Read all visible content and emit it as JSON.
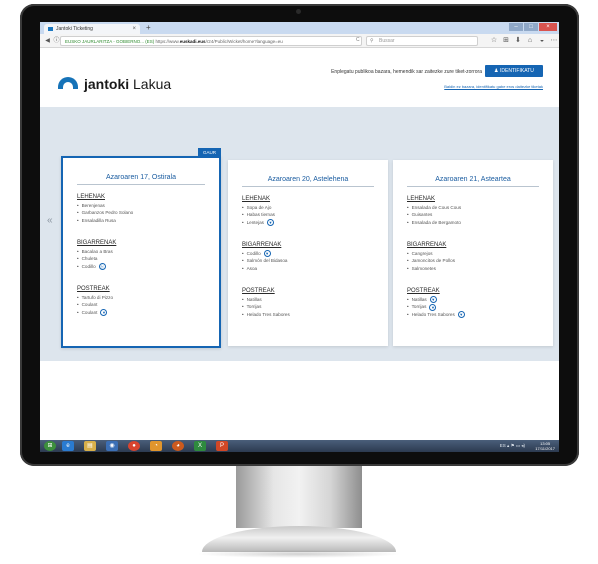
{
  "browser": {
    "tab_title": "Jantoki Ticketing",
    "tab_close": "×",
    "new_tab": "+",
    "window_controls": [
      "–",
      "□",
      "×"
    ],
    "back": "◀",
    "info": "ⓘ",
    "url_secure": "EUSKO JAURLARITZA - GOBIERNO... (ES)",
    "url_prefix": "https://www.",
    "url_host": "euskadi.eus",
    "url_path": "/r24/Public/Wicket/home?language=eu",
    "reload": "C",
    "search_placeholder": "Bussar",
    "toolbar_icons": [
      "☆",
      "⊞",
      "⬇",
      "⌂",
      "◒",
      "⋯",
      "≡"
    ]
  },
  "header": {
    "logo_name": "jantoki",
    "logo_suffix": "Lakua",
    "message": "Enplegatu publikoa bazara, hemendik sar zaitezke zure tiket-zorrora",
    "login_button": "IDENTIFIKATU",
    "link": "Baldin ez bazara, identifikatu gabe eros daitezke tiketak"
  },
  "carousel": {
    "prev": "«",
    "next": "»",
    "today_badge": "GAUR"
  },
  "days": [
    {
      "title": "Azaroaren 17, Ostirala",
      "sections": [
        {
          "heading": "LEHENAK",
          "items": [
            {
              "name": "Berenjenas",
              "badge": ""
            },
            {
              "name": "Garbanzos Pedro Solano",
              "badge": ""
            },
            {
              "name": "Ensaladilla Rusa",
              "badge": ""
            }
          ]
        },
        {
          "heading": "BIGARRENAK",
          "items": [
            {
              "name": "Bacalao a Bras",
              "badge": ""
            },
            {
              "name": "Chuleta",
              "badge": ""
            },
            {
              "name": "Codillo",
              "badge": "ⓚ"
            }
          ]
        },
        {
          "heading": "POSTREAK",
          "items": [
            {
              "name": "Tartufo di Pizzo",
              "badge": ""
            },
            {
              "name": "Coulant",
              "badge": ""
            },
            {
              "name": "Coulant",
              "badge": "▼"
            }
          ]
        }
      ]
    },
    {
      "title": "Azaroaren 20, Astelehena",
      "sections": [
        {
          "heading": "LEHENAK",
          "items": [
            {
              "name": "Sopa de Ajo",
              "badge": ""
            },
            {
              "name": "Habas tiernas",
              "badge": ""
            },
            {
              "name": "Lentejas",
              "badge": "▼"
            }
          ]
        },
        {
          "heading": "BIGARRENAK",
          "items": [
            {
              "name": "Codillo",
              "badge": "▼"
            },
            {
              "name": "Salmón del Bidasoa",
              "badge": ""
            },
            {
              "name": "Asoa",
              "badge": ""
            }
          ]
        },
        {
          "heading": "POSTREAK",
          "items": [
            {
              "name": "Natillas",
              "badge": ""
            },
            {
              "name": "Torrijas",
              "badge": ""
            },
            {
              "name": "Helado Tres Sabores",
              "badge": ""
            }
          ]
        }
      ]
    },
    {
      "title": "Azaroaren 21, Asteartea",
      "sections": [
        {
          "heading": "LEHENAK",
          "items": [
            {
              "name": "Ensalada de Cous Cous",
              "badge": ""
            },
            {
              "name": "Guisantes",
              "badge": ""
            },
            {
              "name": "Ensalada de Bergamoto",
              "badge": ""
            }
          ]
        },
        {
          "heading": "BIGARRENAK",
          "items": [
            {
              "name": "Cangrejos",
              "badge": ""
            },
            {
              "name": "Jamoncitos de Pollos",
              "badge": ""
            },
            {
              "name": "Salmonetes",
              "badge": ""
            }
          ]
        },
        {
          "heading": "POSTREAK",
          "items": [
            {
              "name": "Natillas",
              "badge": "▼"
            },
            {
              "name": "Torrijas",
              "badge": "▼"
            },
            {
              "name": "Helado Tres Sabores",
              "badge": "▼"
            }
          ]
        }
      ]
    }
  ],
  "taskbar": {
    "icons": [
      "⊞",
      "e",
      "▤",
      "◉",
      "●",
      "◔",
      "◕",
      "X",
      "P"
    ],
    "tray": "ES  ▴  ⚑  ▭  ◂)",
    "time": "13:05",
    "date": "17/11/2017"
  },
  "colors": {
    "brand_blue": "#1565b3",
    "band_bg": "#dde5ed",
    "taskbar": "#2c3a50"
  }
}
